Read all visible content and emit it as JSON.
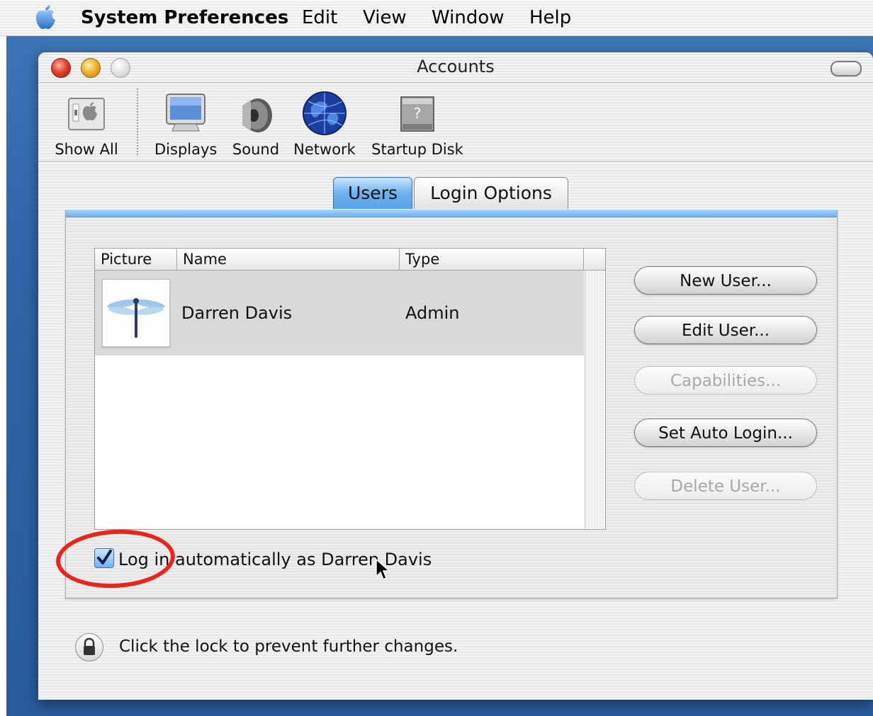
{
  "menubar": {
    "app_name": "System Preferences",
    "items": [
      "Edit",
      "View",
      "Window",
      "Help"
    ]
  },
  "window": {
    "title": "Accounts"
  },
  "toolbar": {
    "items": [
      {
        "label": "Show All",
        "icon": "show-all-icon"
      },
      {
        "label": "Displays",
        "icon": "display-icon"
      },
      {
        "label": "Sound",
        "icon": "speaker-icon"
      },
      {
        "label": "Network",
        "icon": "globe-icon"
      },
      {
        "label": "Startup Disk",
        "icon": "hard-disk-icon"
      }
    ]
  },
  "tabs": [
    {
      "label": "Users",
      "selected": true
    },
    {
      "label": "Login Options",
      "selected": false
    }
  ],
  "table": {
    "columns": [
      "Picture",
      "Name",
      "Type"
    ],
    "rows": [
      {
        "picture": "dragonfly-icon",
        "name": "Darren Davis",
        "type": "Admin"
      }
    ]
  },
  "buttons": {
    "new_user": "New User...",
    "edit_user": "Edit User...",
    "capabilities": "Capabilities...",
    "set_auto_login": "Set Auto Login...",
    "delete_user": "Delete User..."
  },
  "auto_login": {
    "checked": true,
    "label": "Log in automatically as Darren Davis"
  },
  "lock": {
    "text": "Click the lock to prevent further changes."
  },
  "colors": {
    "highlight_circle": "#e8251c",
    "selected_tab": "#6cb2ef",
    "desktop": "#2f64a6"
  }
}
